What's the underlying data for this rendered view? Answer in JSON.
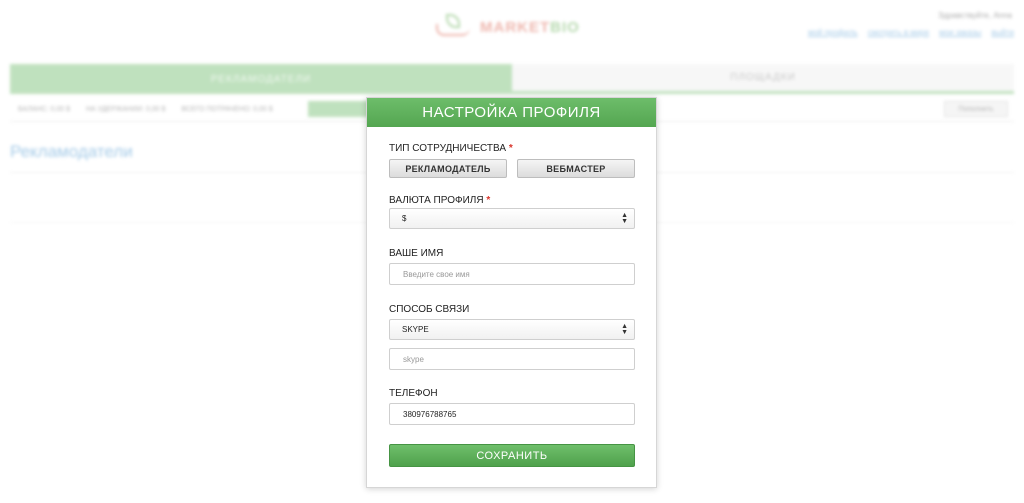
{
  "background": {
    "logo": {
      "part1": "MARKET",
      "part2": "BIO"
    },
    "greeting": "Здравствуйте, Anna",
    "top_links": [
      "мой профиль",
      "смотреть в мире",
      "мои заказы",
      "выйти"
    ],
    "main_tabs": [
      {
        "label": "РЕКЛАМОДАТЕЛИ",
        "active": true
      },
      {
        "label": "ПЛОЩАДКИ",
        "active": false
      }
    ],
    "sub_items": [
      "БАЛАНС: 0,00 $",
      "НА УДЕРЖАНИИ: 0,00 $",
      "ВСЕГО ПОТРАЧЕНО: 0,00 $"
    ],
    "sub_right_button": "Пополнить",
    "page_heading": "Рекламодатели"
  },
  "modal": {
    "title": "НАСТРОЙКА ПРОФИЛЯ",
    "cooperation": {
      "label": "ТИП СОТРУДНИЧЕСТВА",
      "required_mark": "*",
      "options": [
        "РЕКЛАМОДАТЕЛЬ",
        "ВЕБМАСТЕР"
      ]
    },
    "currency": {
      "label": "ВАЛЮТА ПРОФИЛЯ",
      "required_mark": "*",
      "selected": "$"
    },
    "name": {
      "label": "ВАШЕ ИМЯ",
      "placeholder": "Введите свое имя"
    },
    "contact": {
      "label": "СПОСОБ СВЯЗИ",
      "selected": "SKYPE",
      "placeholder": "skype"
    },
    "phone": {
      "label": "ТЕЛЕФОН",
      "value": "380976788765"
    },
    "save_label": "СОХРАНИТЬ"
  },
  "colors": {
    "accent_green": "#54a651",
    "link_blue": "#5a9fd4",
    "required_red": "#d9342b"
  }
}
